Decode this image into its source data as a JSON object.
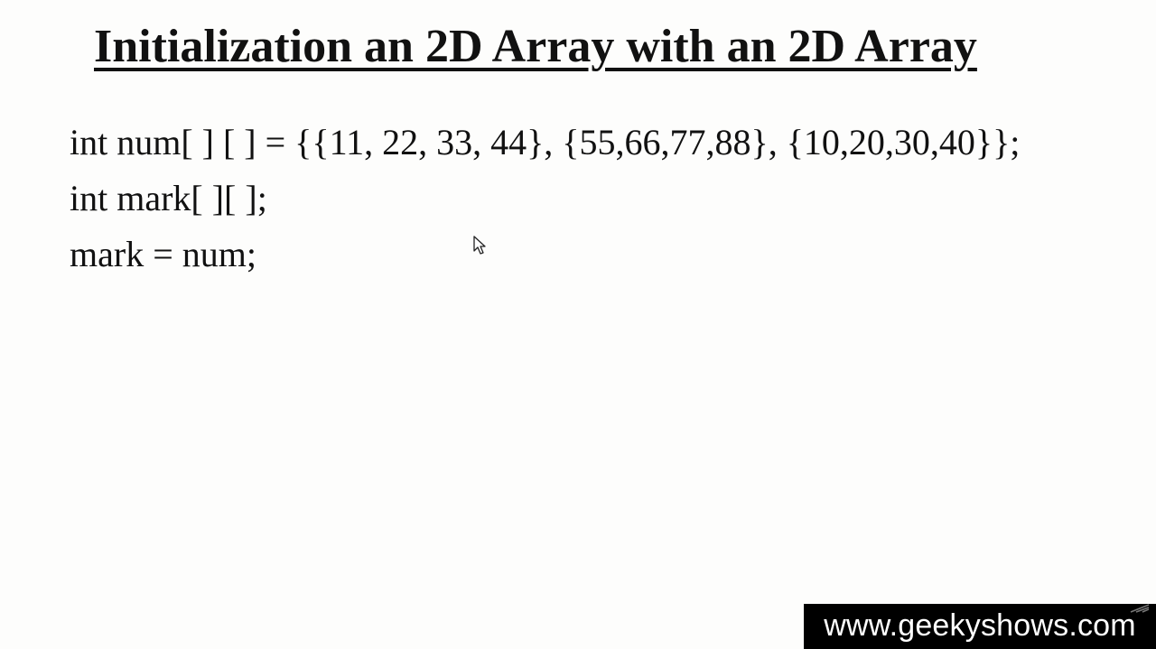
{
  "slide": {
    "title": "Initialization an 2D Array with an 2D Array",
    "code_lines": [
      "int num[ ] [ ] = {{11, 22, 33, 44}, {55,66,77,88}, {10,20,30,40}};",
      "int mark[ ][ ];",
      "mark = num;"
    ]
  },
  "watermark": {
    "text": "www.geekyshows.com"
  },
  "icons": {
    "mouse_cursor": "mouse-pointer-icon"
  },
  "colors": {
    "background": "#fdfdfc",
    "text": "#111111",
    "watermark_background": "#000000",
    "watermark_text": "#ffffff"
  }
}
